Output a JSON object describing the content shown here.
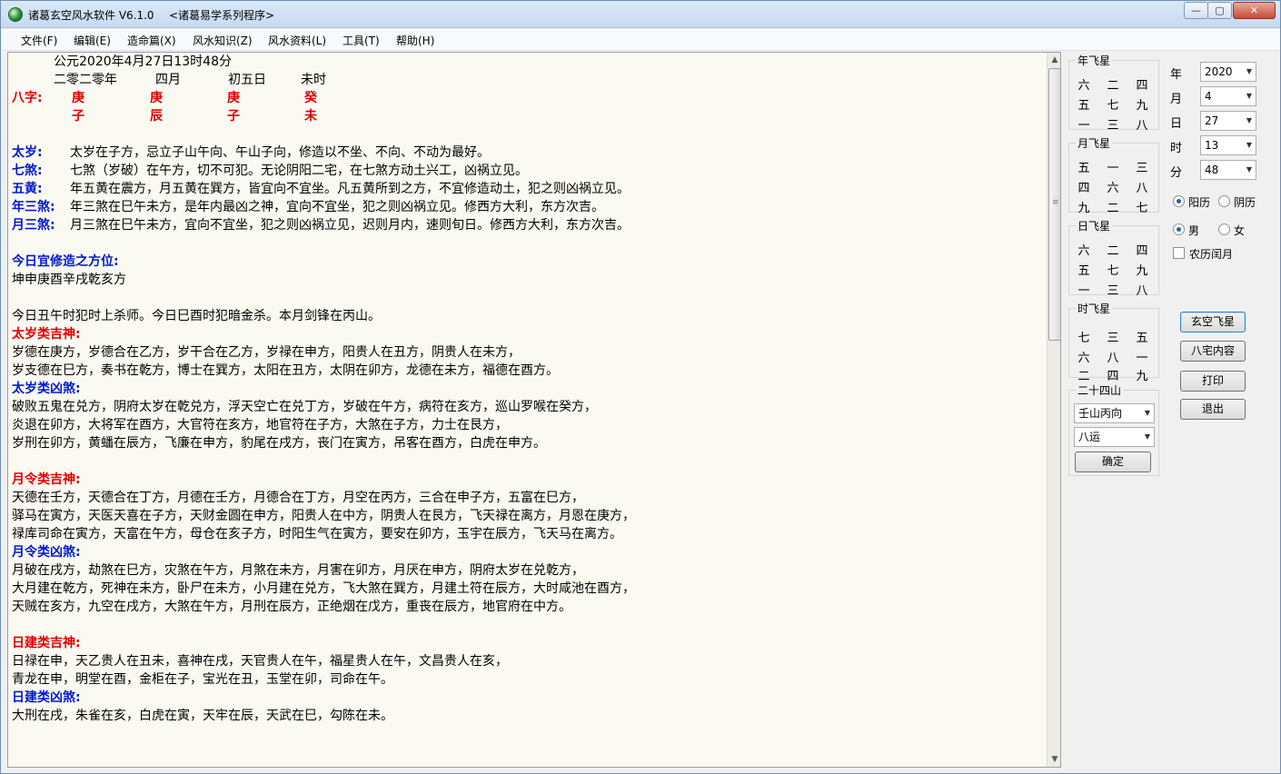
{
  "window": {
    "title": "诸葛玄空风水软件 V6.1.0",
    "subtitle": "<诸葛易学系列程序>",
    "minimize_label": "—",
    "maximize_label": "▢",
    "close_label": "✕"
  },
  "menu": [
    "文件(F)",
    "编辑(E)",
    "造命篇(X)",
    "风水知识(Z)",
    "风水资料(L)",
    "工具(T)",
    "帮助(H)"
  ],
  "content": {
    "date_line": "公元2020年4月27日13时48分",
    "lunar": [
      "二零二零年",
      "四月",
      "初五日",
      "未时"
    ],
    "bazi_label": "八字:",
    "bazi_stems": [
      "庚",
      "庚",
      "庚",
      "癸"
    ],
    "bazi_branches": [
      "子",
      "辰",
      "子",
      "未"
    ],
    "shensha": [
      {
        "label": "太岁:",
        "text": "太岁在子方，忌立子山午向、午山子向，修造以不坐、不向、不动为最好。"
      },
      {
        "label": "七煞:",
        "text": "七煞（岁破）在午方，切不可犯。无论阴阳二宅，在七煞方动土兴工，凶祸立见。"
      },
      {
        "label": "五黄:",
        "text": "年五黄在震方，月五黄在巽方，皆宜向不宜坐。凡五黄所到之方，不宜修造动土，犯之则凶祸立见。"
      },
      {
        "label": "年三煞:",
        "text": "年三煞在巳午未方，是年内最凶之神，宜向不宜坐，犯之则凶祸立见。修西方大利，东方次吉。"
      },
      {
        "label": "月三煞:",
        "text": "月三煞在巳午未方，宜向不宜坐，犯之则凶祸立见，迟则月内，速则旬日。修西方大利，东方次吉。"
      }
    ],
    "today_heading": "今日宜修造之方位:",
    "today_text": "坤申庚酉辛戌乾亥方",
    "today_note": "今日丑午时犯时上杀师。今日巳酉时犯暗金杀。本月剑锋在丙山。",
    "sections": [
      {
        "heading": "太岁类吉神:",
        "color": "red",
        "lines": [
          "岁德在庚方，岁德合在乙方，岁干合在乙方，岁禄在申方，阳贵人在丑方，阴贵人在未方，",
          "岁支德在巳方，奏书在乾方，博士在巽方，太阳在丑方，太阴在卯方，龙德在未方，福德在酉方。"
        ]
      },
      {
        "heading": "太岁类凶煞:",
        "color": "blue",
        "lines": [
          "破败五鬼在兑方，阴府太岁在乾兑方，浮天空亡在兑丁方，岁破在午方，病符在亥方，巡山罗喉在癸方，",
          "炎退在卯方，大将军在酉方，大官符在亥方，地官符在子方，大煞在子方，力士在艮方，",
          "岁刑在卯方，黄蟠在辰方，飞廉在申方，豹尾在戌方，丧门在寅方，吊客在酉方，白虎在申方。"
        ]
      },
      {
        "heading": "月令类吉神:",
        "color": "red",
        "gap_before": true,
        "lines": [
          "天德在壬方，天德合在丁方，月德在壬方，月德合在丁方，月空在丙方，三合在申子方，五富在巳方，",
          "驿马在寅方，天医天喜在子方，天财金圆在申方，阳贵人在中方，阴贵人在艮方，飞天禄在离方，月恩在庚方，",
          "禄库司命在寅方，天富在午方，母仓在亥子方，时阳生气在寅方，要安在卯方，玉宇在辰方，飞天马在离方。"
        ]
      },
      {
        "heading": "月令类凶煞:",
        "color": "blue",
        "lines": [
          "月破在戌方，劫煞在巳方，灾煞在午方，月煞在未方，月害在卯方，月厌在申方，阴府太岁在兑乾方，",
          "大月建在乾方，死神在未方，卧尸在未方，小月建在兑方，飞大煞在巽方，月建土符在辰方，大时咸池在酉方，",
          "天贼在亥方，九空在戌方，大煞在午方，月刑在辰方，正绝烟在戊方，重丧在辰方，地官府在中方。"
        ]
      },
      {
        "heading": "日建类吉神:",
        "color": "red",
        "gap_before": true,
        "lines": [
          "日禄在申，天乙贵人在丑未，喜神在戌，天官贵人在午，福星贵人在午，文昌贵人在亥，",
          "青龙在申，明堂在酉，金柜在子，宝光在丑，玉堂在卯，司命在午。"
        ]
      },
      {
        "heading": "日建类凶煞:",
        "color": "blue",
        "lines": [
          "大刑在戌，朱雀在亥，白虎在寅，天牢在辰，天武在巳，勾陈在未。"
        ]
      }
    ]
  },
  "flying_stars": {
    "year": {
      "title": "年飞星",
      "grid": [
        "六",
        "二",
        "四",
        "五",
        "七",
        "九",
        "一",
        "三",
        "八"
      ]
    },
    "month": {
      "title": "月飞星",
      "grid": [
        "五",
        "一",
        "三",
        "四",
        "六",
        "八",
        "九",
        "二",
        "七"
      ]
    },
    "day": {
      "title": "日飞星",
      "grid": [
        "六",
        "二",
        "四",
        "五",
        "七",
        "九",
        "一",
        "三",
        "八"
      ]
    },
    "hour": {
      "title": "时飞星",
      "grid": [
        "七",
        "三",
        "五",
        "六",
        "八",
        "一",
        "二",
        "四",
        "九"
      ]
    }
  },
  "mountains": {
    "title": "二十四山",
    "direction": "壬山丙向",
    "period": "八运",
    "confirm_label": "确定"
  },
  "date_form": {
    "year_label": "年",
    "year": "2020",
    "month_label": "月",
    "month": "4",
    "day_label": "日",
    "day": "27",
    "hour_label": "时",
    "hour": "13",
    "minute_label": "分",
    "minute": "48",
    "solar_label": "阳历",
    "lunar_label": "阴历",
    "male_label": "男",
    "female_label": "女",
    "leap_label": "农历闰月"
  },
  "buttons": {
    "xuankong": "玄空飞星",
    "bazhai": "八宅内容",
    "print": "打印",
    "exit": "退出"
  },
  "icons": {
    "scroll_up": "▲",
    "scroll_down": "▼",
    "dropdown": "▼",
    "grip": "≡"
  }
}
